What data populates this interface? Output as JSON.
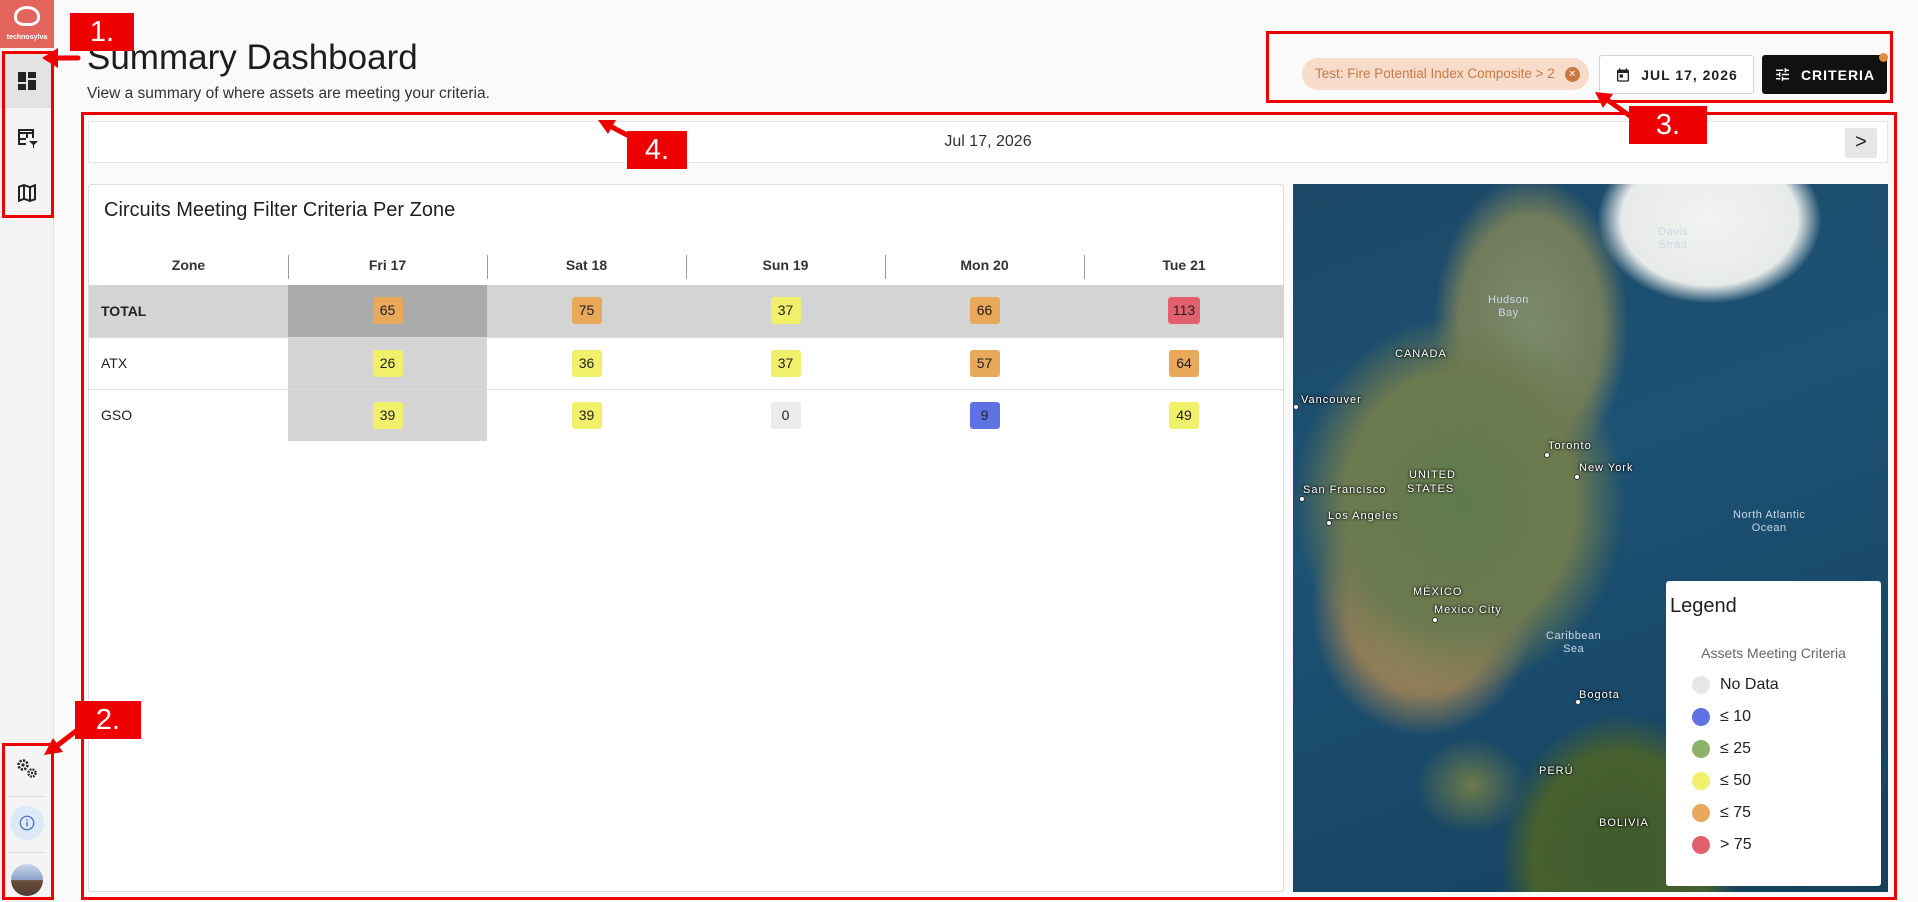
{
  "app": {
    "logo_text": "technosylva"
  },
  "sidebar": {
    "items": [
      {
        "name": "dashboard",
        "icon": "dashboard-icon",
        "active": true
      },
      {
        "name": "table-view",
        "icon": "table-filter-icon",
        "active": false
      },
      {
        "name": "map",
        "icon": "map-icon",
        "active": false
      }
    ],
    "bottom": [
      {
        "name": "settings",
        "icon": "gears-icon"
      },
      {
        "name": "info",
        "icon": "info-icon"
      },
      {
        "name": "profile",
        "icon": "avatar"
      }
    ]
  },
  "header": {
    "title": "Summary Dashboard",
    "subtitle": "View a summary of where assets are meeting your criteria.",
    "filter_chip": "Test: Fire Potential Index Composite > 2",
    "date_button": "JUL 17, 2026",
    "criteria_button": "CRITERIA"
  },
  "datebar": {
    "date": "Jul 17, 2026",
    "next_label": ">"
  },
  "table_panel": {
    "title": "Circuits Meeting Filter Criteria Per Zone",
    "columns": [
      "Zone",
      "Fri 17",
      "Sat 18",
      "Sun 19",
      "Mon 20",
      "Tue 21"
    ],
    "rows": [
      {
        "zone": "TOTAL",
        "values": [
          "65",
          "75",
          "37",
          "66",
          "113"
        ],
        "colors": [
          "#e8a95a",
          "#e8a95a",
          "#f1f06a",
          "#e8a95a",
          "#e1606b"
        ]
      },
      {
        "zone": "ATX",
        "values": [
          "26",
          "36",
          "37",
          "57",
          "64"
        ],
        "colors": [
          "#f1f06a",
          "#f1f06a",
          "#f1f06a",
          "#e8a95a",
          "#e8a95a"
        ]
      },
      {
        "zone": "GSO",
        "values": [
          "39",
          "39",
          "0",
          "9",
          "49"
        ],
        "colors": [
          "#f1f06a",
          "#f1f06a",
          "#ebebeb",
          "#5f72e4",
          "#f1f06a"
        ]
      }
    ]
  },
  "map": {
    "labels": {
      "canada": "CANADA",
      "us_1": "UNITED",
      "us_2": "STATES",
      "mexico": "MÉXICO",
      "peru": "PERÚ",
      "bolivia": "BOLIVIA",
      "vancouver": "Vancouver",
      "toronto": "Toronto",
      "new_york": "New York",
      "san_francisco": "San Francisco",
      "los_angeles": "Los Angeles",
      "mexico_city": "Mexico City",
      "bogota": "Bogota",
      "hudson_1": "Hudson",
      "hudson_2": "Bay",
      "davis_1": "Davis",
      "davis_2": "Strait",
      "atlantic_1": "North Atlantic",
      "atlantic_2": "Ocean",
      "caribbean_1": "Caribbean",
      "caribbean_2": "Sea"
    },
    "legend": {
      "title": "Legend",
      "subtitle": "Assets Meeting Criteria",
      "items": [
        {
          "label": "No Data",
          "color": "#e6e6e6"
        },
        {
          "label": "≤ 10",
          "color": "#5f72e4"
        },
        {
          "label": "≤ 25",
          "color": "#8db36a"
        },
        {
          "label": "≤ 50",
          "color": "#f1f06a"
        },
        {
          "label": "≤ 75",
          "color": "#e8a95a"
        },
        {
          "label": "> 75",
          "color": "#e1606b"
        }
      ]
    }
  },
  "annotations": [
    "1.",
    "2.",
    "3.",
    "4."
  ]
}
